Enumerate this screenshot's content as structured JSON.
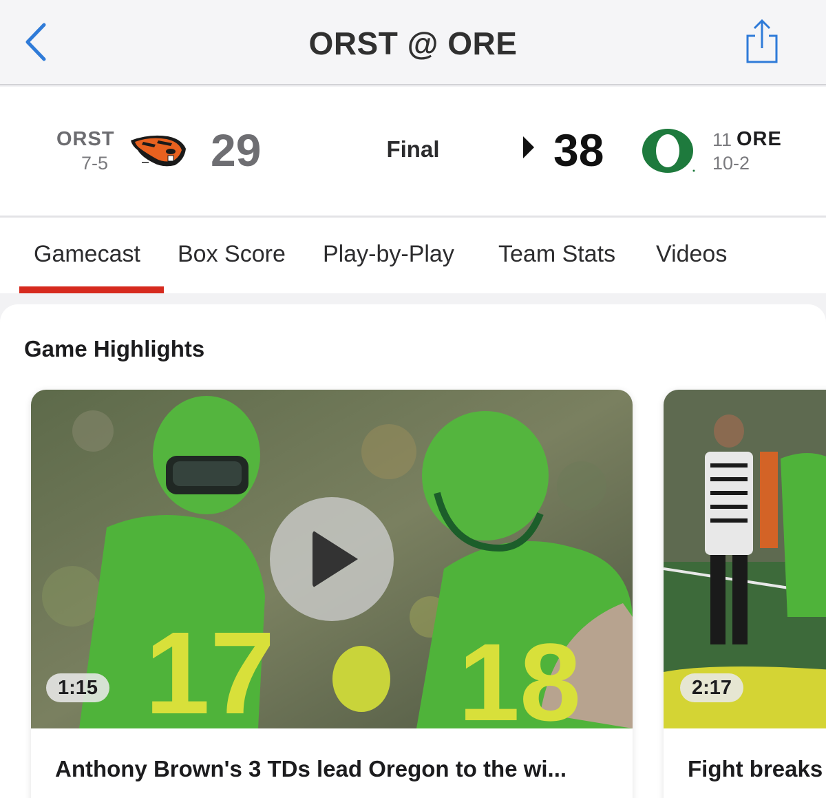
{
  "nav": {
    "title": "ORST @ ORE",
    "back_icon": "chevron-left-icon",
    "share_icon": "share-icon",
    "accent_color": "#2f7bd8"
  },
  "game": {
    "status": "Final",
    "away": {
      "abbr": "ORST",
      "record": "7-5",
      "score": "29",
      "logo": "beaver-logo",
      "color": "#e8611f"
    },
    "home": {
      "abbr": "ORE",
      "rank": "11",
      "record": "10-2",
      "score": "38",
      "logo": "oregon-o-logo",
      "color": "#1e7a3d",
      "winner": true
    }
  },
  "tabs": [
    {
      "label": "Gamecast",
      "active": true
    },
    {
      "label": "Box Score"
    },
    {
      "label": "Play-by-Play"
    },
    {
      "label": "Team Stats"
    },
    {
      "label": "Videos"
    }
  ],
  "tab_indicator_color": "#d62a1e",
  "highlights": {
    "title": "Game Highlights",
    "videos": [
      {
        "duration": "1:15",
        "headline": "Anthony Brown's 3 TDs lead Oregon to the wi...",
        "play_icon": "play-icon"
      },
      {
        "duration": "2:17",
        "headline": "Fight breaks"
      }
    ]
  }
}
